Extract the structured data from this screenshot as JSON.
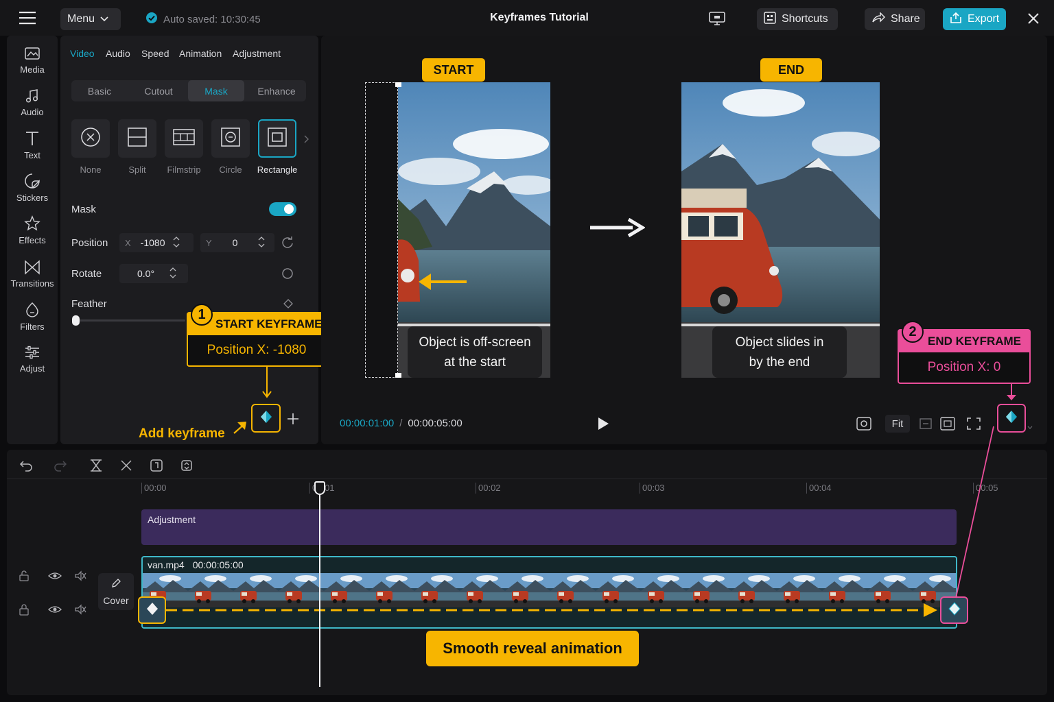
{
  "topbar": {
    "menu_label": "Menu",
    "autosave": "Auto saved: 10:30:45",
    "title": "Keyframes Tutorial",
    "shortcuts_label": "Shortcuts",
    "share_label": "Share",
    "export_label": "Export",
    "accent_color": "#1aa6c4"
  },
  "sidebar": {
    "items": [
      {
        "label": "Media",
        "icon": "media-icon"
      },
      {
        "label": "Audio",
        "icon": "music-note-icon"
      },
      {
        "label": "Text",
        "icon": "text-t-icon"
      },
      {
        "label": "Stickers",
        "icon": "sticker-icon"
      },
      {
        "label": "Effects",
        "icon": "star-icon"
      },
      {
        "label": "Transitions",
        "icon": "bowtie-icon"
      },
      {
        "label": "Filters",
        "icon": "filter-icon"
      },
      {
        "label": "Adjust",
        "icon": "sliders-icon"
      }
    ]
  },
  "panel": {
    "tabs": [
      "Video",
      "Audio",
      "Speed",
      "Animation",
      "Adjustment"
    ],
    "active_tab": "Video",
    "segments": [
      "Basic",
      "Cutout",
      "Mask",
      "Enhance"
    ],
    "active_segment": "Mask",
    "masks": [
      "None",
      "Split",
      "Filmstrip",
      "Circle",
      "Rectangle"
    ],
    "selected_mask": "Rectangle",
    "mask_label": "Mask",
    "mask_enabled": true,
    "position_label": "Position",
    "x_label": "X",
    "x_value": "-1080",
    "y_label": "Y",
    "y_value": "0",
    "rotate_label": "Rotate",
    "rotate_value": "0.0°",
    "feather_label": "Feather",
    "feather_level": 0,
    "add_keyframe_label": "Add keyframe"
  },
  "callouts": {
    "start": {
      "number": "1",
      "title": "START KEYFRAME",
      "value": "Position X: -1080",
      "color": "#f7b500"
    },
    "end": {
      "number": "2",
      "title": "END KEYFRAME",
      "value": "Position X: 0",
      "color": "#ea4e9a"
    }
  },
  "preview": {
    "start_badge": "START",
    "end_badge": "END",
    "start_caption_l1": "Object is off-screen",
    "start_caption_l2": "at the start",
    "end_caption_l1": "Object slides in",
    "end_caption_l2": "by the end",
    "current_time": "00:00:01:00",
    "separator": "/",
    "total_time": "00:00:05:00",
    "fit_label": "Fit"
  },
  "timeline": {
    "ticks": [
      "00:00",
      "00:01",
      "00:02",
      "00:03",
      "00:04",
      "00:05"
    ],
    "adjustment_label": "Adjustment",
    "clip_name": "van.mp4",
    "clip_duration": "00:00:05:00",
    "cover_label": "Cover",
    "animation_label": "Smooth reveal animation",
    "adjustment_color": "#3b2b5c",
    "clip_border_color": "#3fb8c8"
  }
}
